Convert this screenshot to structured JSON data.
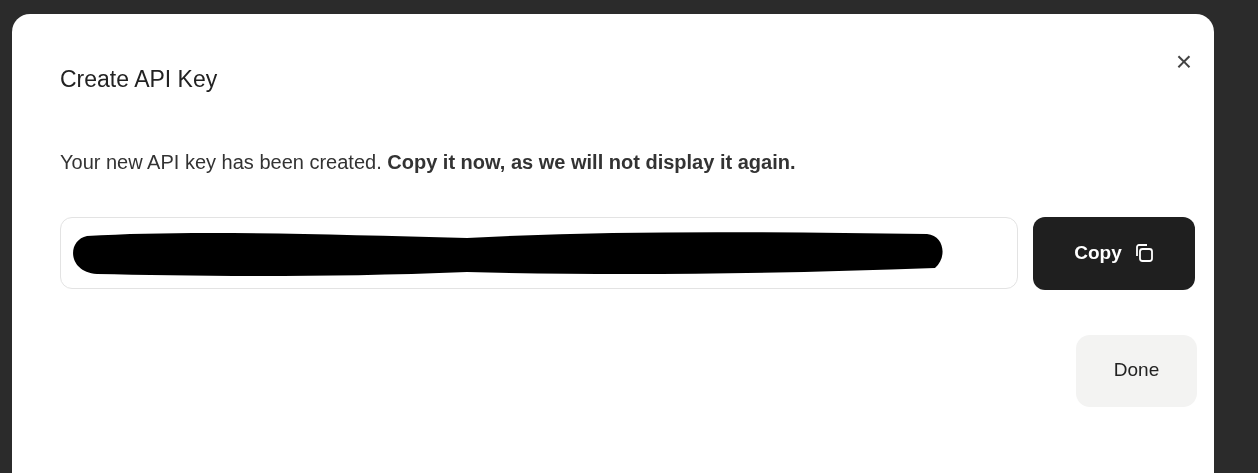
{
  "dialog": {
    "title": "Create API Key",
    "close": "×",
    "message": "Your new API key has been created. **Copy it now, as we will not display it again.**",
    "key_field": {
      "redacted": true
    },
    "copy_button": {
      "label": "Copy"
    },
    "done_button": {
      "label": "Done"
    }
  }
}
